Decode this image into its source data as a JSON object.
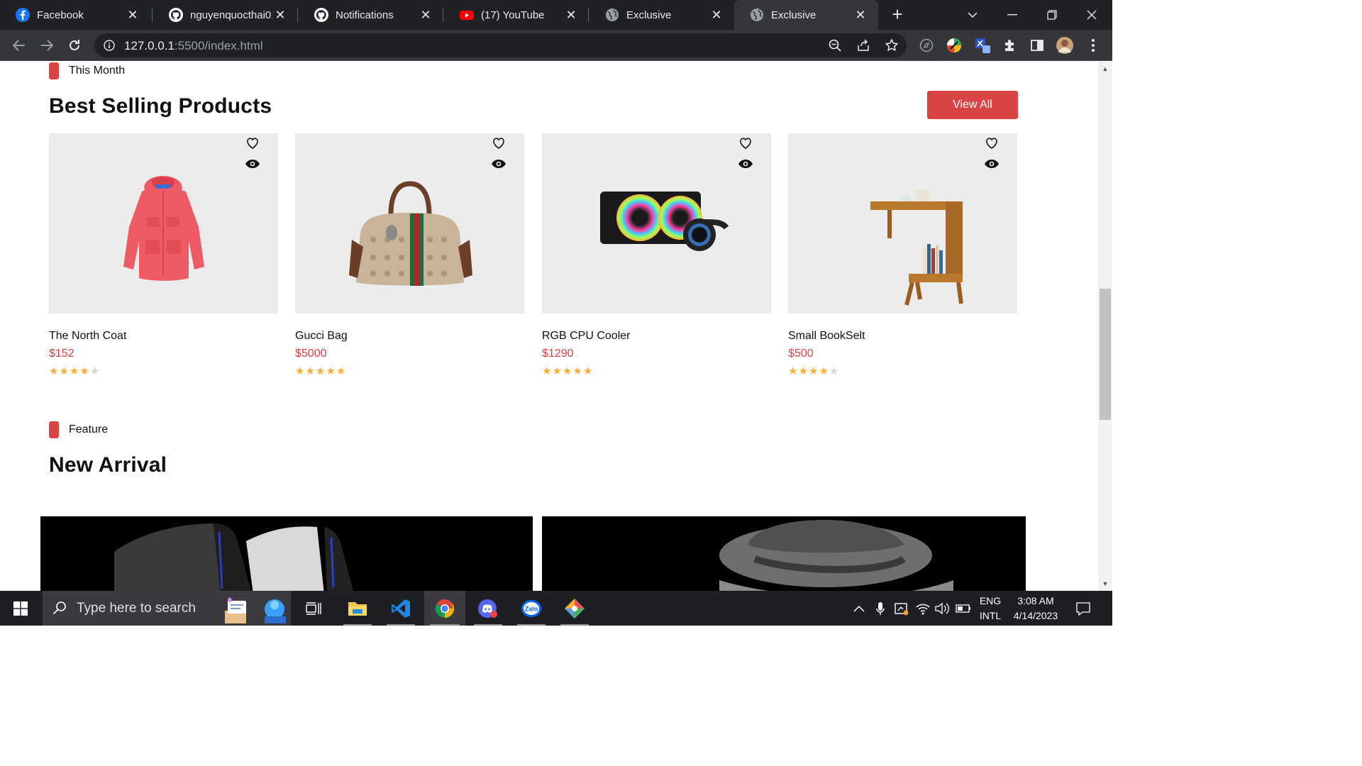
{
  "browser": {
    "tabs": [
      {
        "title": "Facebook",
        "icon": "facebook-icon"
      },
      {
        "title": "nguyenquocthai01(",
        "icon": "github-icon"
      },
      {
        "title": "Notifications",
        "icon": "github-icon"
      },
      {
        "title": "(17) YouTube",
        "icon": "youtube-icon"
      },
      {
        "title": "Exclusive",
        "icon": "globe-icon"
      },
      {
        "title": "Exclusive",
        "icon": "globe-icon",
        "active": true
      }
    ],
    "url_host": "127.0.0.1",
    "url_rest": ":5500/index.html"
  },
  "best_selling": {
    "tag": "This Month",
    "title": "Best Selling Products",
    "view_all": "View All",
    "products": [
      {
        "name": "The North Coat",
        "price": "$152",
        "rating": 4
      },
      {
        "name": "Gucci Bag",
        "price": "$5000",
        "rating": 5
      },
      {
        "name": "RGB CPU Cooler",
        "price": "$1290",
        "rating": 5
      },
      {
        "name": "Small BookSelt",
        "price": "$500",
        "rating": 4
      }
    ]
  },
  "new_arrival": {
    "tag": "Feature",
    "title": "New Arrival"
  },
  "taskbar": {
    "search_placeholder": "Type here to search",
    "lang_top": "ENG",
    "lang_bottom": "INTL",
    "time": "3:08 AM",
    "date": "4/14/2023"
  },
  "colors": {
    "accent": "#db4444",
    "star": "#ffad33"
  }
}
